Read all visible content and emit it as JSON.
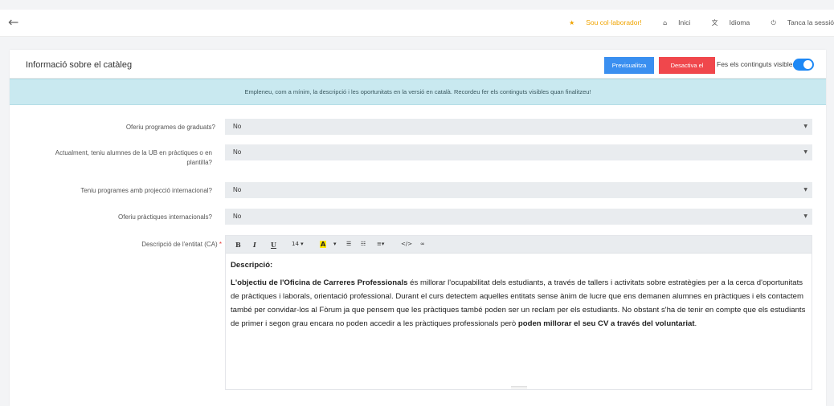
{
  "topbar": {
    "back_icon": "arrow-left-icon",
    "collaborator": "Sou col·laborador!",
    "home": "Inici",
    "language": "Idioma",
    "logout": "Tanca la sessió"
  },
  "card": {
    "title": "Informació sobre el catàleg",
    "preview_button": "Previsualitza",
    "disable_button": "Desactiva el catàleg",
    "visible_label": "Fes els continguts visibles",
    "visible_toggle_on": true,
    "toggle_color": "#1e88f5"
  },
  "banner": {
    "text": "Empleneu, com a mínim, la descripció i les oportunitats en la versió en català. Recordeu fer els continguts visibles quan finalitzeu!"
  },
  "form": {
    "q1": {
      "label": "Oferiu programes de graduats?",
      "value": "No"
    },
    "q2": {
      "label_line1": "Actualment, teniu alumnes de la UB en pràctiques o en",
      "label_line2": "plantilla?",
      "value": "No"
    },
    "q3": {
      "label": "Teniu programes amb projecció internacional?",
      "value": "No"
    },
    "q4": {
      "label": "Oferiu pràctiques internacionals?",
      "value": "No"
    },
    "description_label": "Descripció de l'entitat (CA)",
    "required_mark": "*"
  },
  "editor": {
    "toolbar": {
      "bold": "B",
      "italic": "I",
      "underline": "U",
      "font_size": "14",
      "color_letter": "A"
    },
    "heading": "Descripció:",
    "para_bold_start": "L'objectiu de l'Oficina de Carreres Professionals",
    "para_middle": " és millorar l'ocupabilitat dels estudiants, a través de tallers i activitats sobre estratègies per a la cerca d'oportunitats de pràctiques i laborals, orientació professional. Durant el curs detectem aquelles entitats sense ànim de lucre que ens demanen alumnes en pràctiques i els contactem també per convidar-los al Fòrum ja que pensem que les pràctiques també poden ser un reclam per els estudiants. No obstant s'ha de tenir en compte que els estudiants de primer i segon grau encara no poden accedir a les pràctiques professionals però ",
    "para_bold_end": "poden millorar el seu CV a través del voluntariat",
    "para_end": "."
  }
}
